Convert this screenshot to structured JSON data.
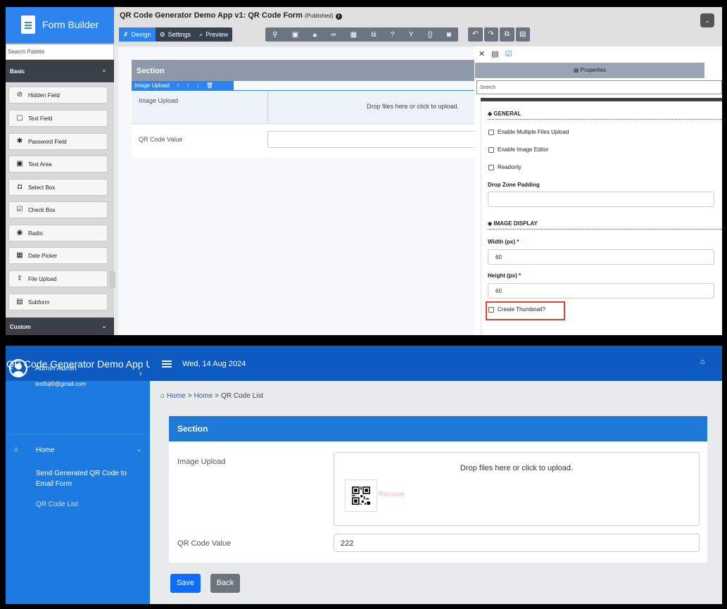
{
  "form_builder": {
    "logo_text": "Form Builder",
    "palette_search_placeholder": "Search Palette",
    "categories": {
      "basic": "Basic",
      "custom": "Custom"
    },
    "palette_items": [
      {
        "label": "Hidden Field",
        "icon": "eye-slash-icon"
      },
      {
        "label": "Text Field",
        "icon": "text-field-icon"
      },
      {
        "label": "Password Field",
        "icon": "asterisk-icon"
      },
      {
        "label": "Text Area",
        "icon": "text-area-icon"
      },
      {
        "label": "Select Box",
        "icon": "select-box-icon"
      },
      {
        "label": "Check Box",
        "icon": "checkbox-icon"
      },
      {
        "label": "Radio",
        "icon": "radio-icon"
      },
      {
        "label": "Date Picker",
        "icon": "calendar-icon"
      },
      {
        "label": "File Upload",
        "icon": "upload-icon"
      },
      {
        "label": "Subform",
        "icon": "file-icon"
      }
    ],
    "title": "QR Code Generator Demo App v1: QR Code Form",
    "status": "(Published)",
    "tabs": {
      "design": "Design",
      "settings": "Settings",
      "preview": "Preview"
    },
    "section_title": "Section",
    "field_toolbar_label": "Image Upload",
    "image_upload_label": "Image Upload",
    "drop_text": "Drop files here or click to upload.",
    "qr_label": "QR Code Value",
    "properties": {
      "tab_label": "Properties",
      "search_placeholder": "Search",
      "general_heading": "GENERAL",
      "enable_multiple": "Enable Multiple Files Upload",
      "enable_editor": "Enable Image Editor",
      "readonly": "Readonly",
      "drop_zone_padding": "Drop Zone Padding",
      "image_display_heading": "IMAGE DISPLAY",
      "width_label": "Width (px)",
      "width_value": "60",
      "height_label": "Height (px)",
      "height_value": "60",
      "required_mark": "*",
      "create_thumbnail": "Create Thumbnail?"
    },
    "highlight_color": "#e8402a"
  },
  "app": {
    "brand": "QR Code Generator Demo App U",
    "date": "Wed, 14 Aug 2024",
    "user_name": "Admin Admin",
    "user_email": "testfuji0@gmail.com",
    "nav_home": "Home",
    "nav_send_form": "Send Generated QR Code to Email Form",
    "nav_qr_list": "QR Code List",
    "breadcrumb": [
      "Home",
      "Home",
      "QR Code List"
    ],
    "breadcrumb_sep": ">",
    "section_title": "Section",
    "image_upload_label": "Image Upload",
    "drop_text": "Drop files here or click to upload.",
    "remove_label": "Remove",
    "qr_label": "QR Code Value",
    "qr_value": "222",
    "save_label": "Save",
    "back_label": "Back",
    "colors": {
      "sidebar": "#1c7ae0",
      "topbar": "#0d5ac0",
      "primary": "#0d6efd"
    }
  }
}
